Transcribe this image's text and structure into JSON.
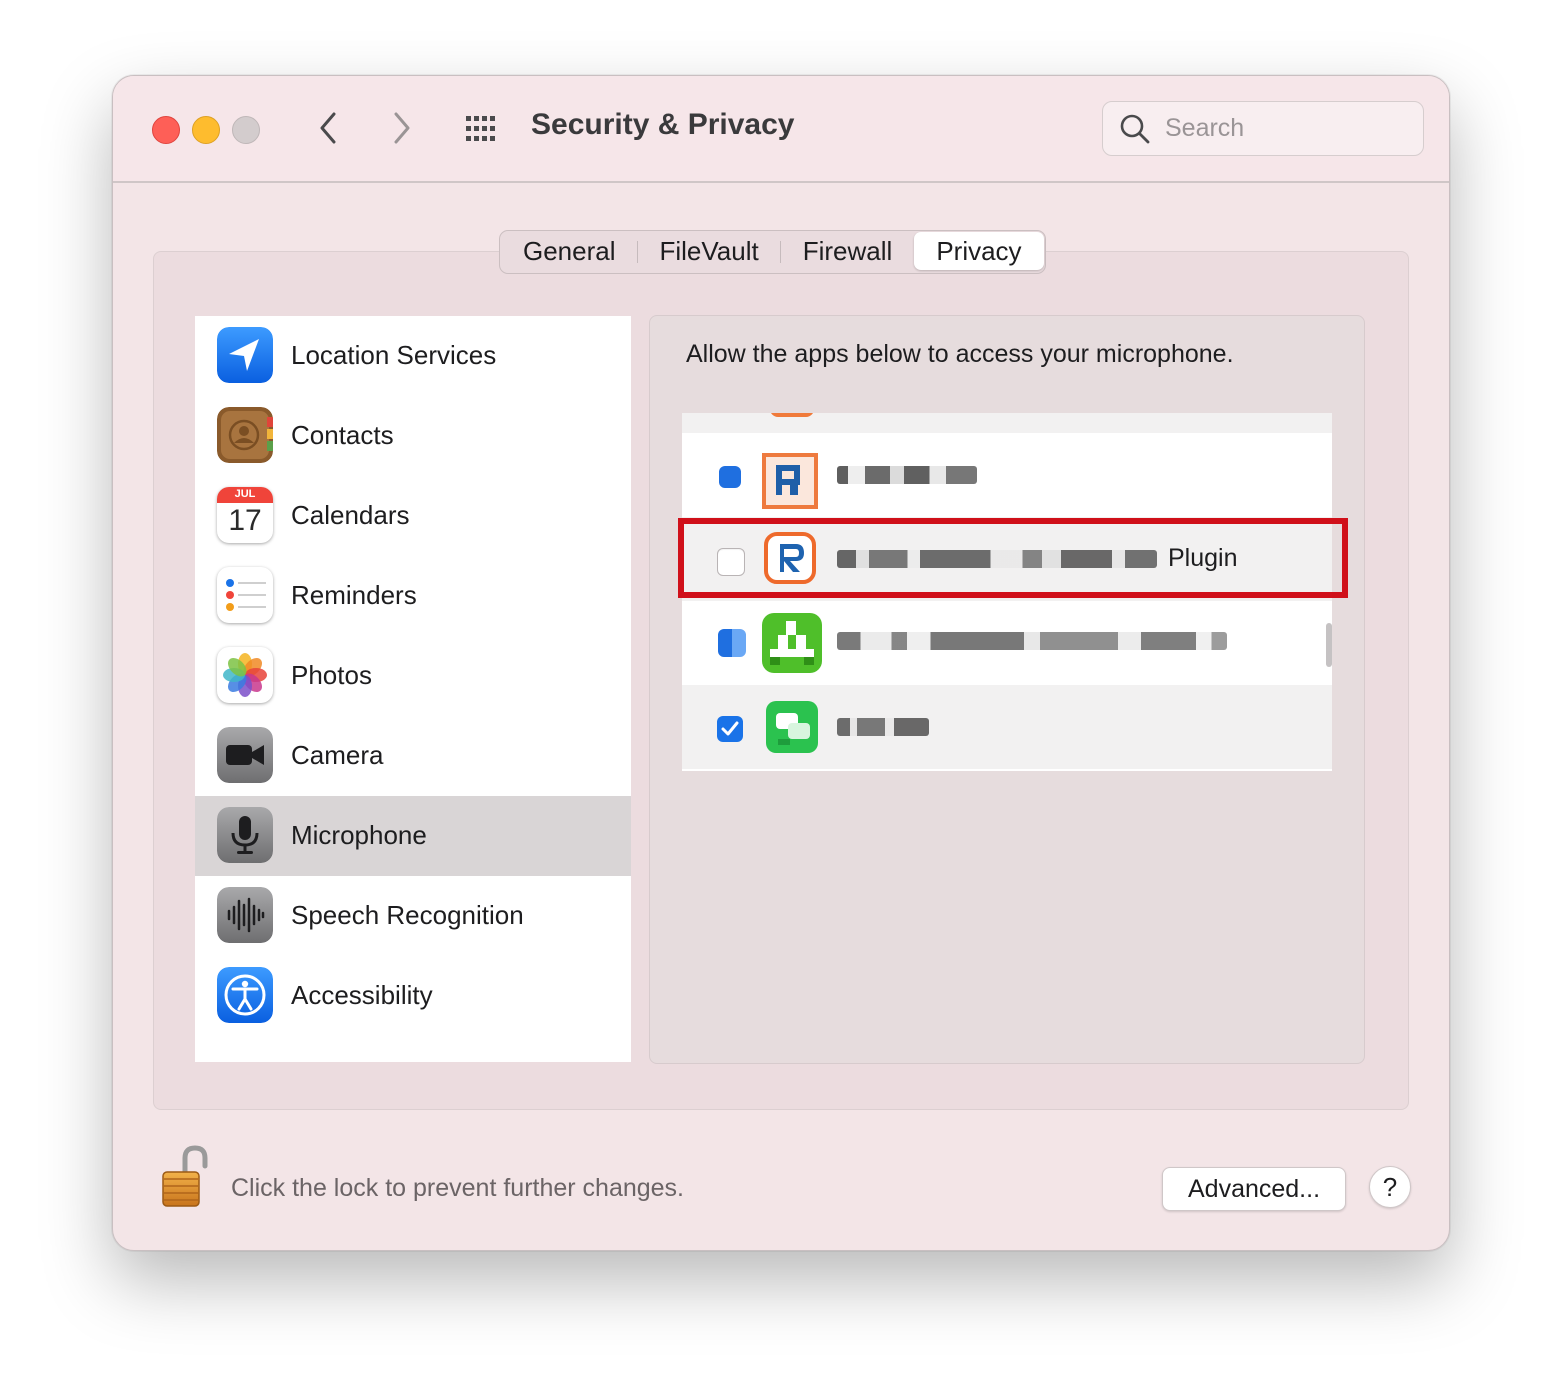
{
  "window": {
    "title": "Security & Privacy",
    "search_placeholder": "Search"
  },
  "tabs": [
    "General",
    "FileVault",
    "Firewall",
    "Privacy"
  ],
  "active_tab": "Privacy",
  "sidebar": {
    "selected": "Microphone",
    "items": [
      {
        "label": "Location Services",
        "icon": "location-arrow-icon"
      },
      {
        "label": "Contacts",
        "icon": "contacts-icon"
      },
      {
        "label": "Calendars",
        "icon": "calendar-icon",
        "icon_month": "JUL",
        "icon_day": "17"
      },
      {
        "label": "Reminders",
        "icon": "reminders-icon"
      },
      {
        "label": "Photos",
        "icon": "photos-icon"
      },
      {
        "label": "Camera",
        "icon": "video-camera-icon"
      },
      {
        "label": "Microphone",
        "icon": "microphone-icon"
      },
      {
        "label": "Speech Recognition",
        "icon": "waveform-icon"
      },
      {
        "label": "Accessibility",
        "icon": "accessibility-icon"
      }
    ]
  },
  "apps_panel": {
    "description": "Allow the apps below to access your microphone.",
    "apps": [
      {
        "name_visible": "",
        "checked": null,
        "icon": "pixelated-app-icon"
      },
      {
        "name_visible": "Plugin",
        "checked": false,
        "icon": "r-logo-app-icon",
        "highlighted": true
      },
      {
        "name_visible": "",
        "checked": null,
        "icon": "green-app-icon"
      },
      {
        "name_visible": "",
        "checked": true,
        "icon": "green-chat-app-icon"
      }
    ]
  },
  "footer": {
    "lock_text": "Click the lock to prevent further changes.",
    "advanced_label": "Advanced...",
    "help_label": "?"
  },
  "colors": {
    "window_bg": "#f3e5e7",
    "selection_gray": "#d9d5d6",
    "accent_blue": "#1a73e8",
    "highlight_red": "#d0101a"
  }
}
